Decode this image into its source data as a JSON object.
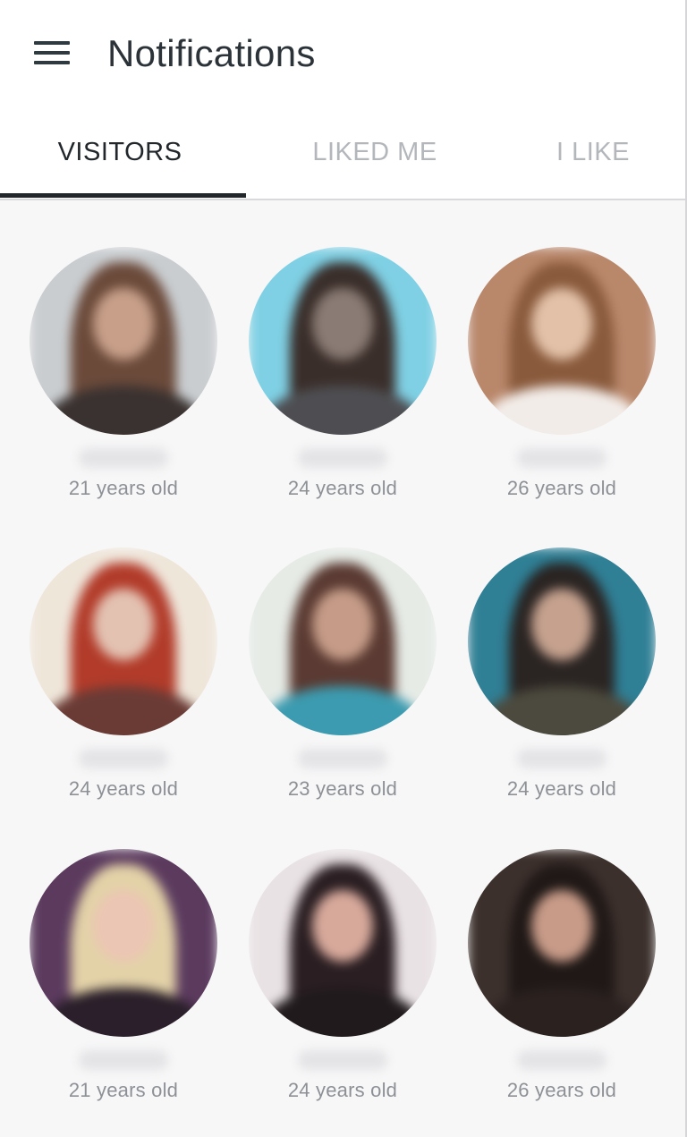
{
  "header": {
    "title": "Notifications",
    "menu_icon": "hamburger-menu-icon"
  },
  "tabs": [
    {
      "label": "VISITORS",
      "active": true
    },
    {
      "label": "LIKED ME",
      "active": false
    },
    {
      "label": "I LIKE",
      "active": false
    }
  ],
  "profiles": [
    {
      "age_text": "21 years old",
      "palette": {
        "bg": "#c9cdd0",
        "hair": "#6b4a3a",
        "face": "#c8a08a",
        "body": "#3a3230"
      }
    },
    {
      "age_text": "24 years old",
      "palette": {
        "bg": "#7fd0e4",
        "hair": "#3a2e2a",
        "face": "#8a7b74",
        "body": "#4e4e52"
      }
    },
    {
      "age_text": "26 years old",
      "palette": {
        "bg": "#b9876a",
        "hair": "#8a5a3c",
        "face": "#e2c1a8",
        "body": "#f2ece8"
      }
    },
    {
      "age_text": "24 years old",
      "palette": {
        "bg": "#efe6da",
        "hair": "#b23b2a",
        "face": "#e3c2b2",
        "body": "#6a3b35"
      }
    },
    {
      "age_text": "23 years old",
      "palette": {
        "bg": "#e6ebe6",
        "hair": "#5a3a32",
        "face": "#c69c88",
        "body": "#3c9bb0"
      }
    },
    {
      "age_text": "24 years old",
      "palette": {
        "bg": "#2f7f95",
        "hair": "#2a2422",
        "face": "#c5a18e",
        "body": "#4c4a3e"
      }
    },
    {
      "age_text": "21 years old",
      "palette": {
        "bg": "#5b3a5e",
        "hair": "#e3d2a8",
        "face": "#ecc6b4",
        "body": "#2a1f2a"
      }
    },
    {
      "age_text": "24 years old",
      "palette": {
        "bg": "#e9e2e4",
        "hair": "#2a1e22",
        "face": "#d7a99b",
        "body": "#201a1c"
      }
    },
    {
      "age_text": "26 years old",
      "palette": {
        "bg": "#3c302c",
        "hair": "#1f1816",
        "face": "#c89b88",
        "body": "#2b2220"
      }
    }
  ]
}
